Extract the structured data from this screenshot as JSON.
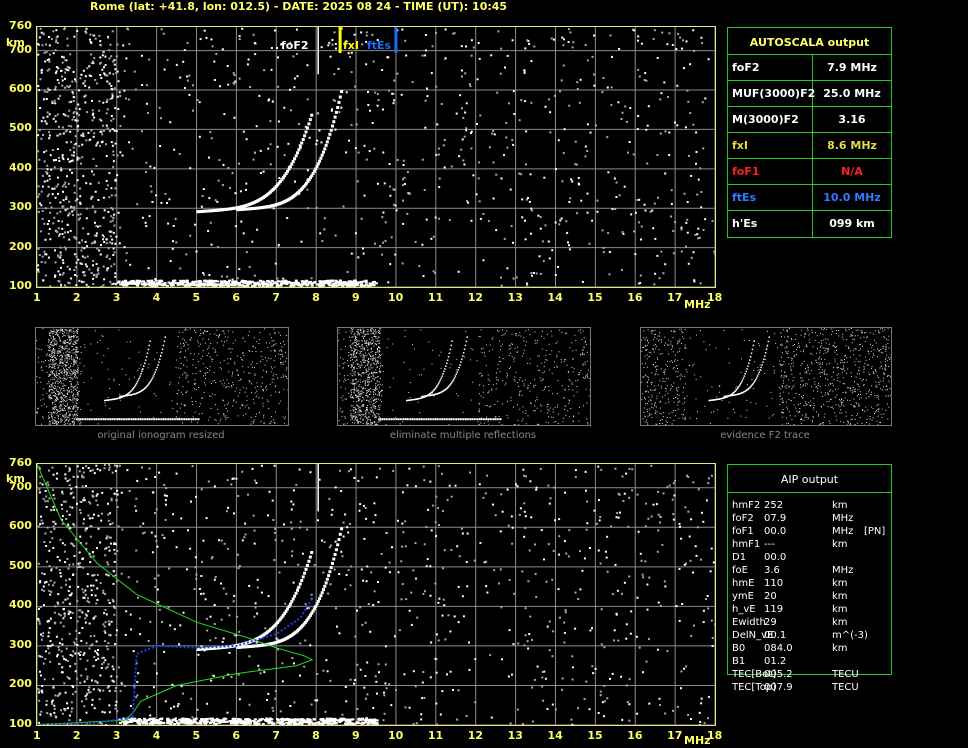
{
  "header": "Rome (lat: +41.8, lon: 012.5) - DATE: 2025 08 24 - TIME (UT): 10:45",
  "x_ticks": [
    "1",
    "2",
    "3",
    "4",
    "5",
    "6",
    "7",
    "8",
    "9",
    "10",
    "11",
    "12",
    "13",
    "14",
    "15",
    "16",
    "17",
    "18"
  ],
  "x_unit": "MHz",
  "y_ticks": [
    "760",
    "700",
    "600",
    "500",
    "400",
    "300",
    "200",
    "100"
  ],
  "y_unit": "km",
  "top_markers": {
    "fof2": "foF2",
    "fxi": "fxI",
    "ftes": "ftEs"
  },
  "colors": {
    "grid": "#8a8a8a",
    "frame": "#e6e680",
    "marker_yellow": "#ffff00",
    "marker_blue": "#1e6cff",
    "table_border": "#22cc22",
    "profile": "#22dd22",
    "trace": "#1a3cff"
  },
  "autoscala": {
    "title": "AUTOSCALA output",
    "rows": [
      {
        "label": "foF2",
        "value": "7.9 MHz",
        "color": "#ffffff"
      },
      {
        "label": "MUF(3000)F2",
        "value": "25.0 MHz",
        "color": "#ffffff"
      },
      {
        "label": "M(3000)F2",
        "value": "3.16",
        "color": "#ffffff"
      },
      {
        "label": "fxI",
        "value": "8.6 MHz",
        "color": "#e6d84a"
      },
      {
        "label": "foF1",
        "value": "N/A",
        "color": "#ff2020"
      },
      {
        "label": "ftEs",
        "value": "10.0 MHz",
        "color": "#2f7bff"
      },
      {
        "label": "h'Es",
        "value": "099     km",
        "color": "#ffffff"
      }
    ]
  },
  "thumbs": {
    "caption1": "original ionogram resized",
    "caption2": "eliminate multiple reflections",
    "caption3": "evidence F2 trace"
  },
  "aip": {
    "title": "AIP output",
    "rows": [
      {
        "name": "hmF2",
        "val": "252",
        "unit": "km",
        "extra": ""
      },
      {
        "name": "foF2",
        "val": "07.9",
        "unit": "MHz",
        "extra": ""
      },
      {
        "name": "foF1",
        "val": "00.0",
        "unit": "MHz",
        "extra": "[PN]"
      },
      {
        "name": "hmF1",
        "val": "---",
        "unit": "km",
        "extra": ""
      },
      {
        "name": "D1",
        "val": "00.0",
        "unit": "",
        "extra": ""
      },
      {
        "name": "foE",
        "val": "3.6",
        "unit": "MHz",
        "extra": ""
      },
      {
        "name": "hmE",
        "val": "110",
        "unit": "km",
        "extra": ""
      },
      {
        "name": "ymE",
        "val": "20",
        "unit": "km",
        "extra": ""
      },
      {
        "name": "h_vE",
        "val": "119",
        "unit": "km",
        "extra": ""
      },
      {
        "name": "Ewidth",
        "val": "29",
        "unit": "km",
        "extra": ""
      },
      {
        "name": "DelN_vE",
        "val": "00.1",
        "unit": "m^(-3)",
        "extra": ""
      },
      {
        "name": "B0",
        "val": "084.0",
        "unit": "km",
        "extra": ""
      },
      {
        "name": "B1",
        "val": "01.2",
        "unit": "",
        "extra": ""
      },
      {
        "name": "TEC[Bot]",
        "val": "005.2",
        "unit": "TECU",
        "extra": ""
      },
      {
        "name": "TEC[Top]",
        "val": "007.9",
        "unit": "TECU",
        "extra": ""
      }
    ]
  }
}
